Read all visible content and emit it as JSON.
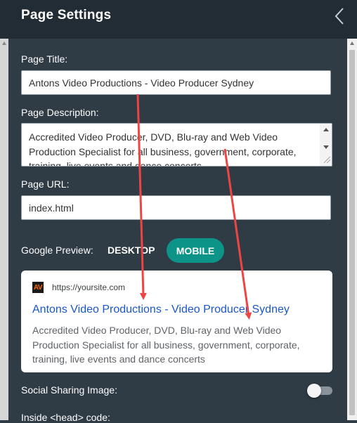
{
  "header": {
    "title": "Page Settings"
  },
  "icons": {
    "back": "chevron-left-icon",
    "favicon": "site-favicon-icon"
  },
  "fields": {
    "title_label": "Page Title:",
    "title_value": "Antons Video Productions - Video Producer Sydney",
    "description_label": "Page Description:",
    "description_value": "Accredited Video Producer, DVD, Blu-ray and Web Video Production Specialist for all business, government, corporate, training, live events and dance concerts",
    "url_label": "Page URL:",
    "url_value": "index.html"
  },
  "preview": {
    "label": "Google Preview:",
    "tabs": [
      "DESKTOP",
      "MOBILE"
    ],
    "selected_tab": "MOBILE",
    "favicon_text": "AV",
    "url": "https://yoursite.com",
    "title": "Antons Video Productions - Video Producer Sydney",
    "description": "Accredited Video Producer, DVD, Blu-ray and Web Video Production Specialist for all business, government, corporate, training, live events and dance concerts"
  },
  "social": {
    "label": "Social Sharing Image:",
    "enabled": false
  },
  "head_code": {
    "label": "Inside <head> code:"
  },
  "colors": {
    "background": "#2f3b45",
    "header": "#222c35",
    "accent": "#0c9488",
    "link": "#1a57c8",
    "annotation": "#ef4444"
  }
}
